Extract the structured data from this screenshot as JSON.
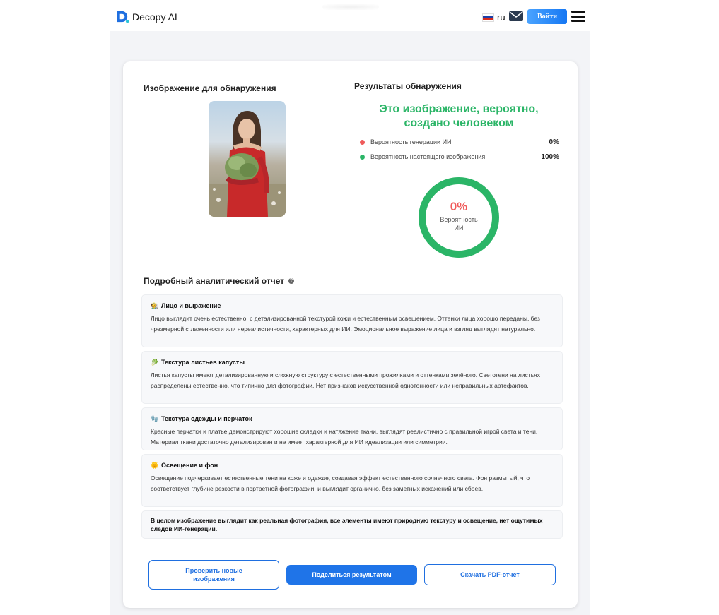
{
  "header": {
    "brand": "Decopy AI",
    "language": "ru",
    "login_label": "Войти",
    "icons": {
      "mail": "mail-icon",
      "menu": "menu-icon",
      "flag": "russian-flag-icon"
    }
  },
  "left": {
    "title": "Изображение для обнаружения"
  },
  "results": {
    "title": "Результаты обнаружения",
    "verdict": "Это изображение, вероятно, создано человеком",
    "rows": [
      {
        "label": "Вероятность генерации ИИ",
        "value": "0%",
        "color": "#ef5b5b"
      },
      {
        "label": "Вероятность настоящего изображения",
        "value": "100%",
        "color": "#2bb567"
      }
    ],
    "gauge": {
      "percent_text": "0%",
      "label": "Вероятность ИИ",
      "ai_fraction": 0,
      "ring_color": "#2bb567"
    }
  },
  "report": {
    "title": "Подробный аналитический отчет",
    "sections": [
      {
        "emoji": "🧑‍🌾",
        "heading": "Лицо и выражение",
        "body": "Лицо выглядит очень естественно, с детализированной текстурой кожи и естественным освещением. Оттенки лица хорошо переданы, без чрезмерной сглаженности или нереалистичности, характерных для ИИ. Эмоциональное выражение лица и взгляд выглядят натурально."
      },
      {
        "emoji": "🥬",
        "heading": "Текстура листьев капусты",
        "body": "Листья капусты имеют детализированную и сложную структуру с естественными прожилками и оттенками зелёного. Светотени на листьях распределены естественно, что типично для фотографии. Нет признаков искусственной однотонности или неправильных артефактов."
      },
      {
        "emoji": "🧤",
        "heading": "Текстура одежды и перчаток",
        "body": "Красные перчатки и платье демонстрируют хорошие складки и натяжение ткани, выглядят реалистично с правильной игрой света и тени. Материал ткани достаточно детализирован и не имеет характерной для ИИ идеализации или симметрии."
      },
      {
        "emoji": "🌞",
        "heading": "Освещение и фон",
        "body": "Освещение подчеркивает естественные тени на коже и одежде, создавая эффект естественного солнечного света. Фон размытый, что соответствует глубине резкости в портретной фотографии, и выглядит органично, без заметных искажений или сбоев."
      }
    ],
    "summary": "В целом изображение выглядит как реальная фотография, все элементы имеют природную текстуру и освещение, нет ощутимых следов ИИ-генерации."
  },
  "actions": {
    "check_new": "Проверить новые изображения",
    "share": "Поделиться результатом",
    "download": "Скачать PDF-отчет"
  }
}
